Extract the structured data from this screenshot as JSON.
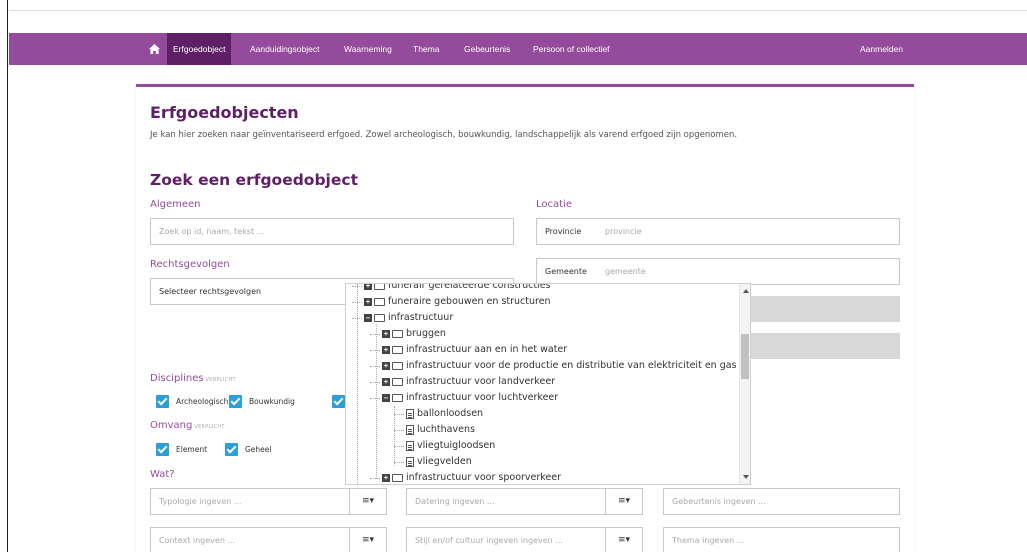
{
  "nav": {
    "items": [
      "Erfgoedobject",
      "Aanduidingsobject",
      "Waarneming",
      "Thema",
      "Gebeurtenis",
      "Persoon of collectief"
    ],
    "active": "Erfgoedobject",
    "login": "Aanmelden"
  },
  "page": {
    "title": "Erfgoedobjecten",
    "intro": "Je kan hier zoeken naar geïnventariseerd erfgoed. Zowel archeologisch, bouwkundig, landschappelijk als varend erfgoed zijn opgenomen.",
    "search_title": "Zoek een erfgoedobject"
  },
  "algemeen": {
    "label": "Algemeen",
    "placeholder": "Zoek op id, naam, tekst ..."
  },
  "locatie": {
    "label": "Locatie",
    "provincie_label": "Provincie",
    "provincie_placeholder": "provincie",
    "gemeente_label": "Gemeente",
    "gemeente_placeholder": "gemeente"
  },
  "rechtsgevolgen": {
    "label": "Rechtsgevolgen",
    "select": "Selecteer rechtsgevolgen"
  },
  "disciplines": {
    "label": "Disciplines",
    "tag": "VERPLICHT",
    "options": [
      "Archeologisch",
      "Bouwkundig"
    ]
  },
  "omvang": {
    "label": "Omvang",
    "tag": "VERPLICHT",
    "options": [
      "Element",
      "Geheel"
    ]
  },
  "wat": {
    "label": "Wat?",
    "typologie": "Typologie ingeven ...",
    "datering": "Datering ingeven ...",
    "gebeurtenis": "Gebeurtenis ingeven ...",
    "context": "Context ingeven ...",
    "stijl": "Stijl en/of cultuur ingeven ingeven ...",
    "thema": "Thema ingeven ...",
    "menu_symbol": "≡▾"
  },
  "tree": [
    {
      "label": "funerair gerelateerde constructies",
      "type": "folder",
      "sign": "+"
    },
    {
      "label": "funeraire gebouwen en structuren",
      "type": "folder",
      "sign": "+"
    },
    {
      "label": "infrastructuur",
      "type": "folder-open",
      "sign": "−"
    },
    {
      "label": "bruggen",
      "type": "folder",
      "sign": "+"
    },
    {
      "label": "infrastructuur aan en in het water",
      "type": "folder",
      "sign": "+"
    },
    {
      "label": "infrastructuur voor de productie en distributie van elektriciteit en gas",
      "type": "folder",
      "sign": "+"
    },
    {
      "label": "infrastructuur voor landverkeer",
      "type": "folder",
      "sign": "+"
    },
    {
      "label": "infrastructuur voor luchtverkeer",
      "type": "folder-open",
      "sign": "−"
    },
    {
      "label": "ballonloodsen",
      "type": "file"
    },
    {
      "label": "luchthavens",
      "type": "file"
    },
    {
      "label": "vliegtuigloodsen",
      "type": "file"
    },
    {
      "label": "vliegvelden",
      "type": "file"
    },
    {
      "label": "infrastructuur voor spoorverkeer",
      "type": "folder",
      "sign": "+"
    }
  ],
  "colors": {
    "brand": "#944b9c",
    "brand_dark": "#5f1f66",
    "checkbox": "#2a9fd8"
  }
}
